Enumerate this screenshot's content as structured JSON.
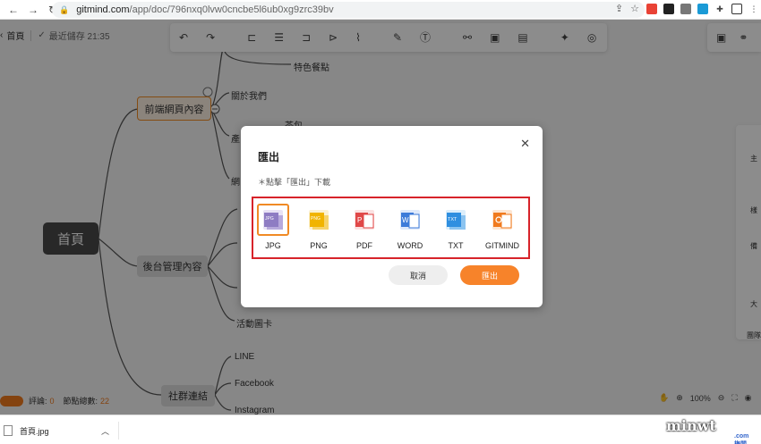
{
  "browser": {
    "url_host": "gitmind.com",
    "url_path": "/app/doc/796nxq0lvw0cncbe5l6ub0xg9zrc39bv"
  },
  "header": {
    "home_label": "首頁",
    "saved_label": "最近儲存 21:35"
  },
  "mindmap": {
    "root": "首頁",
    "branch_web": "前端網頁內容",
    "branch_admin": "後台管理內容",
    "branch_social": "社群連結",
    "leaf_specials": "特色餐點",
    "leaf_about": "關於我們",
    "leaf_tea": "茶包",
    "leaf_event": "活動圖卡",
    "leaf_line": "LINE",
    "leaf_facebook": "Facebook",
    "leaf_instagram": "Instagram",
    "leaf_cut1": "產",
    "leaf_cut2": "網"
  },
  "right_rail": {
    "item1": "主",
    "item2": "樣",
    "item3": "備",
    "item4": "大",
    "item5": "團隊"
  },
  "modal": {
    "title": "匯出",
    "hint": "＊點擊「匯出」下載",
    "formats": [
      {
        "label": "JPG",
        "badge": "JPG",
        "color": "#8e7cc3"
      },
      {
        "label": "PNG",
        "badge": "PNG",
        "color": "#f1b400"
      },
      {
        "label": "PDF",
        "badge": "",
        "color": "#e04848"
      },
      {
        "label": "WORD",
        "badge": "",
        "color": "#3d7bd9"
      },
      {
        "label": "TXT",
        "badge": "TXT",
        "color": "#2f8fe0"
      },
      {
        "label": "GITMIND",
        "badge": "",
        "color": "#f07a1e"
      }
    ],
    "cancel_label": "取消",
    "export_label": "匯出"
  },
  "status": {
    "comments_label": "評論:",
    "comments_count": "0",
    "nodes_label": "節點總數:",
    "nodes_count": "22",
    "zoom": "100%"
  },
  "download": {
    "filename": "首頁.jpg"
  },
  "watermark": {
    "text": "minwt",
    "sub": ".com 梅問題"
  },
  "colors": {
    "accent": "#f7832a",
    "highlight_frame": "#d7232a"
  }
}
